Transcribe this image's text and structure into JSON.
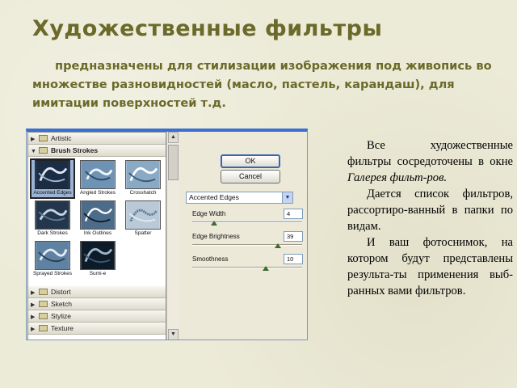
{
  "slide": {
    "title": "Художественные фильтры",
    "subtitle": "предназначены для стилизации изображения под живопись во множестве разновидностей (масло, пастель, карандаш), для имитации поверхностей т.д."
  },
  "side_text": {
    "p1_a": "Все художественные фильтры сосредоточены в окне ",
    "p1_em": "Галерея фильт-ров.",
    "p2": "Дается список фильтров, рассортиро-ванный в папки по видам.",
    "p3": "И ваш фотоснимок, на котором будут представлены результа-ты применения выб-ранных вами фильтров."
  },
  "gallery": {
    "categories_top": [
      {
        "label": "Artistic",
        "open": false
      },
      {
        "label": "Brush Strokes",
        "open": true
      }
    ],
    "thumbnails": [
      {
        "label": "Accented Edges",
        "selected": true
      },
      {
        "label": "Angled Strokes",
        "selected": false
      },
      {
        "label": "Crosshatch",
        "selected": false
      },
      {
        "label": "Dark Strokes",
        "selected": false
      },
      {
        "label": "Ink Outlines",
        "selected": false
      },
      {
        "label": "Spatter",
        "selected": false
      },
      {
        "label": "Sprayed Strokes",
        "selected": false
      },
      {
        "label": "Sumi-e",
        "selected": false
      }
    ],
    "categories_bottom": [
      {
        "label": "Distort"
      },
      {
        "label": "Sketch"
      },
      {
        "label": "Stylize"
      },
      {
        "label": "Texture"
      }
    ],
    "ok_label": "OK",
    "cancel_label": "Cancel",
    "filter_select": "Accented Edges",
    "params": [
      {
        "label": "Edge Width",
        "value": "4",
        "level": 0.2
      },
      {
        "label": "Edge Brightness",
        "value": "39",
        "level": 0.78
      },
      {
        "label": "Smoothness",
        "value": "10",
        "level": 0.67
      }
    ]
  },
  "colors": {
    "title": "#6b6a2a",
    "background": "#ecebd8",
    "window_accent": "#3b6fcf"
  }
}
